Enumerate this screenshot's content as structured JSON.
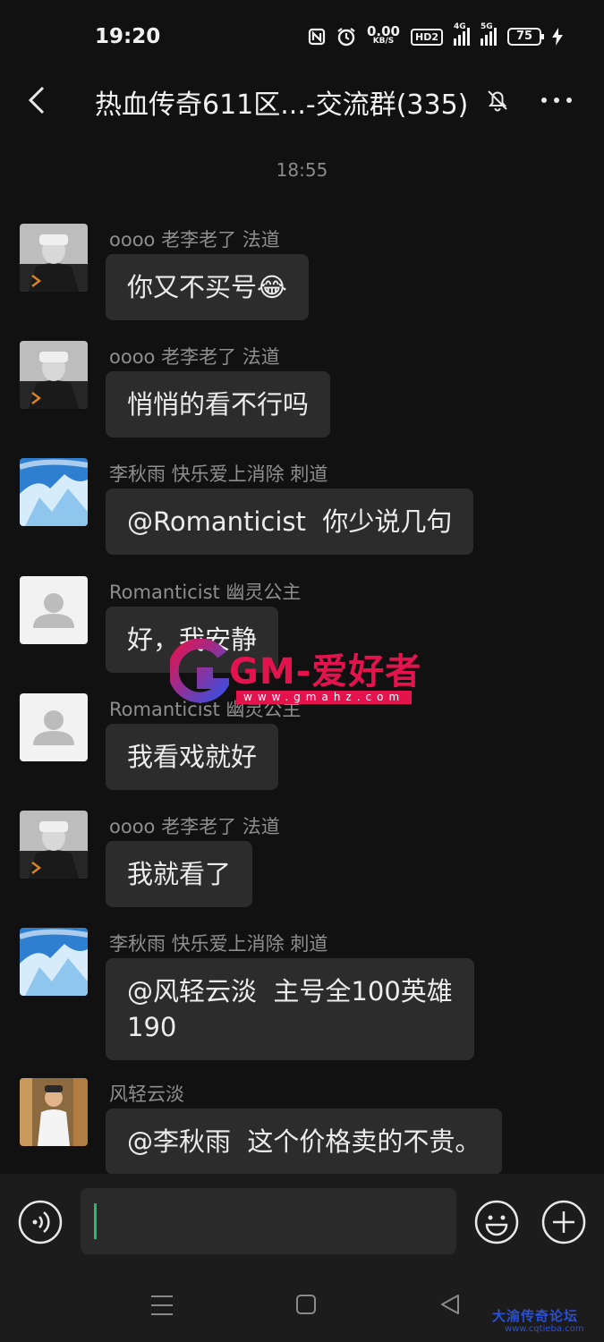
{
  "status_bar": {
    "time": "19:20",
    "net_speed_value": "0.00",
    "net_speed_unit": "KB/S",
    "hd_label": "HD2",
    "sim1_label": "4G",
    "sim2_label": "5G",
    "battery": "75",
    "icons": [
      "nfc-icon",
      "alarm-icon",
      "hd-icon",
      "signal-4g-icon",
      "signal-5g-icon",
      "battery-icon",
      "charging-icon"
    ]
  },
  "header": {
    "title": "热血传奇611区...-交流群(335)",
    "icons": [
      "back-icon",
      "mute-bell-icon",
      "more-icon"
    ]
  },
  "timestamp": "18:55",
  "messages": [
    {
      "sender": "oooo  老李老了  法道",
      "text": "你又不买号😂",
      "avatar": "dark-hoodie"
    },
    {
      "sender": "oooo  老李老了  法道",
      "text": "悄悄的看不行吗",
      "avatar": "dark-hoodie"
    },
    {
      "sender": "李秋雨  快乐爱上消除  刺道",
      "text": "@Romanticist  你少说几句",
      "avatar": "ice-mountain"
    },
    {
      "sender": "Romanticist  幽灵公主",
      "text": "好，我安静",
      "avatar": "default-person"
    },
    {
      "sender": "Romanticist  幽灵公主",
      "text": "我看戏就好",
      "avatar": "default-person"
    },
    {
      "sender": "oooo  老李老了  法道",
      "text": "我就看了",
      "avatar": "dark-hoodie"
    },
    {
      "sender": "李秋雨  快乐爱上消除  刺道",
      "text": "@风轻云淡  主号全100英雄\n190",
      "avatar": "ice-mountain"
    },
    {
      "sender": "风轻云淡",
      "text": "@李秋雨  这个价格卖的不贵。",
      "avatar": "photo-person"
    }
  ],
  "input_bar": {
    "value": "",
    "icons": [
      "voice-icon",
      "emoji-icon",
      "plus-icon"
    ]
  },
  "nav_bar": {
    "icons": [
      "menu-icon",
      "home-icon",
      "back-triangle-icon"
    ]
  },
  "watermarks": {
    "center_text": "GM-爱好者",
    "center_url": "www.gmahz.com",
    "corner_text": "大渝传奇论坛",
    "corner_url": "www.cqtieba.com"
  },
  "colors": {
    "background": "#111111",
    "bubble": "#2c2c2c",
    "input_bar": "#1c1c1c",
    "cursor": "#1fbf6a",
    "watermark_red": "#e4134e",
    "corner_blue": "#2a50d8"
  }
}
